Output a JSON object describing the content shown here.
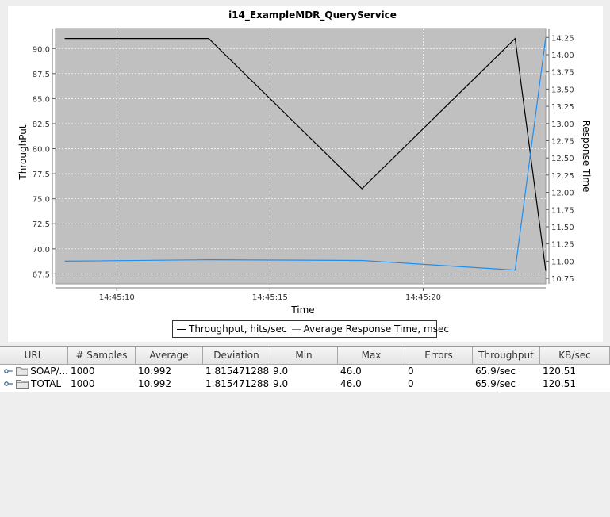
{
  "chart_data": {
    "type": "line",
    "title": "i14_ExampleMDR_QueryService",
    "xlabel": "Time",
    "ylabel_left": "ThroughPut",
    "ylabel_right": "Response Time",
    "x_ticks": [
      "14:45:10",
      "14:45:15",
      "14:45:20"
    ],
    "x_range": [
      "14:45:08",
      "14:45:24"
    ],
    "y_left_ticks": [
      "90.0",
      "87.5",
      "85.0",
      "82.5",
      "80.0",
      "77.5",
      "75.0",
      "72.5",
      "70.0",
      "67.5"
    ],
    "y_left_range": [
      66.5,
      92.0
    ],
    "y_right_ticks": [
      "14.25",
      "14.00",
      "13.75",
      "13.50",
      "13.25",
      "13.00",
      "12.75",
      "12.50",
      "12.25",
      "12.00",
      "11.75",
      "11.50",
      "11.25",
      "11.00",
      "10.75"
    ],
    "y_right_range": [
      10.67,
      14.38
    ],
    "grid": true,
    "legend_placement": "bottom",
    "series": [
      {
        "name": "Throughput, hits/sec",
        "axis": "left",
        "color": "#000000",
        "x": [
          "14:45:08.3",
          "14:45:13.0",
          "14:45:18.0",
          "14:45:23.0",
          "14:45:24.0"
        ],
        "values": [
          91.0,
          91.0,
          76.0,
          91.0,
          67.8
        ]
      },
      {
        "name": "Average Response Time, msec",
        "axis": "right",
        "color": "#1f8ff0",
        "x": [
          "14:45:08.3",
          "14:45:13.0",
          "14:45:18.0",
          "14:45:23.0",
          "14:45:24.0"
        ],
        "values": [
          11.0,
          11.02,
          11.01,
          10.87,
          14.25
        ]
      }
    ]
  },
  "table": {
    "columns": [
      "URL",
      "# Samples",
      "Average",
      "Deviation",
      "Min",
      "Max",
      "Errors",
      "Throughput",
      "KB/sec"
    ],
    "rows": [
      {
        "url": "SOAP/...",
        "samples": "1000",
        "average": "10.992",
        "deviation": "1.815471288...",
        "min": "9.0",
        "max": "46.0",
        "errors": "0",
        "throughput": "65.9/sec",
        "kbsec": "120.51"
      },
      {
        "url": "TOTAL",
        "samples": "1000",
        "average": "10.992",
        "deviation": "1.815471288...",
        "min": "9.0",
        "max": "46.0",
        "errors": "0",
        "throughput": "65.9/sec",
        "kbsec": "120.51"
      }
    ]
  },
  "icons": {
    "expand": "key-connector-icon",
    "folder": "folder-icon"
  }
}
